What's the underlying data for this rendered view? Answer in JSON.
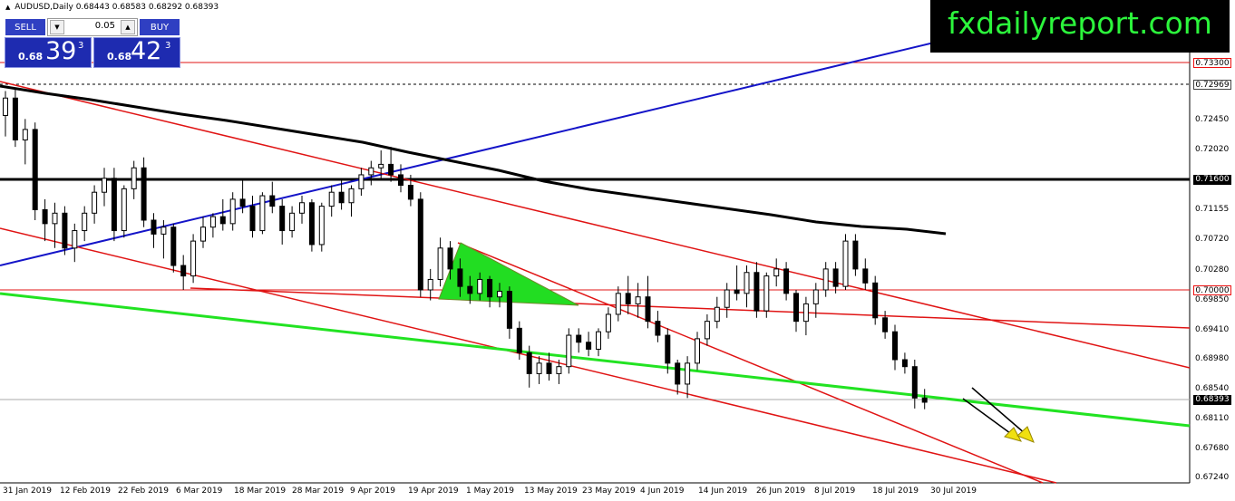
{
  "window": {
    "symbol_title": "AUDUSD,Daily",
    "ohlc": "0.68443 0.68583 0.68292 0.68393"
  },
  "trade_panel": {
    "sell_label": "SELL",
    "buy_label": "BUY",
    "lot_value": "0.05",
    "sell_price": {
      "prefix": "0.68",
      "big": "39",
      "sup": "3"
    },
    "buy_price": {
      "prefix": "0.68",
      "big": "42",
      "sup": "3"
    }
  },
  "watermark": "fxdailyreport.com",
  "price_axis": {
    "labels": [
      "0.72450",
      "0.72020",
      "0.71155",
      "0.70720",
      "0.70280",
      "0.69850",
      "0.69410",
      "0.68980",
      "0.68540",
      "0.68110",
      "0.67680",
      "0.67240"
    ],
    "tags": {
      "resistance_high": "0.73300",
      "dashed_level": "0.72969",
      "black_level": "0.71600",
      "round_level": "0.70000",
      "current_price": "0.68393"
    }
  },
  "time_axis": [
    "31 Jan 2019",
    "12 Feb 2019",
    "22 Feb 2019",
    "6 Mar 2019",
    "18 Mar 2019",
    "28 Mar 2019",
    "9 Apr 2019",
    "19 Apr 2019",
    "1 May 2019",
    "13 May 2019",
    "23 May 2019",
    "4 Jun 2019",
    "14 Jun 2019",
    "26 Jun 2019",
    "8 Jul 2019",
    "18 Jul 2019",
    "30 Jul 2019"
  ],
  "colors": {
    "trend_red": "#e01414",
    "trend_blue": "#1414c8",
    "support_green": "#22e322",
    "moving_average": "#000000",
    "triangle_fill": "#22dd22",
    "arrow_yellow": "#f0e010",
    "sell_button": "#2f3fc2",
    "logo_text": "#2cf53c"
  },
  "candles": [
    [
      0.725,
      0.7285,
      0.722,
      0.7275
    ],
    [
      0.7275,
      0.729,
      0.7205,
      0.7215
    ],
    [
      0.7215,
      0.7245,
      0.718,
      0.723
    ],
    [
      0.723,
      0.724,
      0.71,
      0.7115
    ],
    [
      0.7115,
      0.713,
      0.707,
      0.7095
    ],
    [
      0.7095,
      0.7125,
      0.706,
      0.711
    ],
    [
      0.711,
      0.712,
      0.705,
      0.706
    ],
    [
      0.706,
      0.7095,
      0.704,
      0.7085
    ],
    [
      0.7085,
      0.712,
      0.707,
      0.711
    ],
    [
      0.711,
      0.715,
      0.7095,
      0.714
    ],
    [
      0.714,
      0.7175,
      0.712,
      0.716
    ],
    [
      0.716,
      0.7175,
      0.707,
      0.7085
    ],
    [
      0.7085,
      0.715,
      0.7075,
      0.7145
    ],
    [
      0.7145,
      0.7185,
      0.713,
      0.7175
    ],
    [
      0.7175,
      0.719,
      0.709,
      0.71
    ],
    [
      0.71,
      0.711,
      0.706,
      0.708
    ],
    [
      0.708,
      0.71,
      0.7045,
      0.709
    ],
    [
      0.709,
      0.7095,
      0.7025,
      0.7035
    ],
    [
      0.7035,
      0.705,
      0.7,
      0.702
    ],
    [
      0.702,
      0.708,
      0.701,
      0.707
    ],
    [
      0.707,
      0.7105,
      0.706,
      0.709
    ],
    [
      0.709,
      0.711,
      0.7075,
      0.7105
    ],
    [
      0.7105,
      0.713,
      0.7085,
      0.7095
    ],
    [
      0.7095,
      0.714,
      0.7085,
      0.713
    ],
    [
      0.713,
      0.716,
      0.711,
      0.712
    ],
    [
      0.712,
      0.7135,
      0.7075,
      0.7085
    ],
    [
      0.7085,
      0.714,
      0.708,
      0.7135
    ],
    [
      0.7135,
      0.7155,
      0.711,
      0.712
    ],
    [
      0.712,
      0.713,
      0.7065,
      0.7085
    ],
    [
      0.7085,
      0.712,
      0.7075,
      0.711
    ],
    [
      0.711,
      0.7135,
      0.7095,
      0.7125
    ],
    [
      0.7125,
      0.713,
      0.7055,
      0.7065
    ],
    [
      0.7065,
      0.7125,
      0.7055,
      0.712
    ],
    [
      0.712,
      0.715,
      0.7105,
      0.714
    ],
    [
      0.714,
      0.716,
      0.7115,
      0.7125
    ],
    [
      0.7125,
      0.715,
      0.7105,
      0.7145
    ],
    [
      0.7145,
      0.7175,
      0.7135,
      0.7165
    ],
    [
      0.7165,
      0.7185,
      0.715,
      0.7175
    ],
    [
      0.7175,
      0.72,
      0.716,
      0.718
    ],
    [
      0.718,
      0.7205,
      0.7155,
      0.7165
    ],
    [
      0.7165,
      0.718,
      0.714,
      0.715
    ],
    [
      0.715,
      0.7165,
      0.712,
      0.713
    ],
    [
      0.713,
      0.714,
      0.699,
      0.7
    ],
    [
      0.7,
      0.703,
      0.6985,
      0.7015
    ],
    [
      0.7015,
      0.7075,
      0.7005,
      0.706
    ],
    [
      0.706,
      0.707,
      0.7015,
      0.703
    ],
    [
      0.703,
      0.7045,
      0.699,
      0.7005
    ],
    [
      0.7005,
      0.702,
      0.698,
      0.6995
    ],
    [
      0.6995,
      0.7025,
      0.6985,
      0.7015
    ],
    [
      0.7015,
      0.702,
      0.6975,
      0.699
    ],
    [
      0.699,
      0.701,
      0.6975,
      0.6998
    ],
    [
      0.6998,
      0.7005,
      0.693,
      0.6945
    ],
    [
      0.6945,
      0.6955,
      0.69,
      0.691
    ],
    [
      0.691,
      0.692,
      0.686,
      0.688
    ],
    [
      0.688,
      0.6905,
      0.6865,
      0.6895
    ],
    [
      0.6895,
      0.691,
      0.687,
      0.688
    ],
    [
      0.688,
      0.69,
      0.6865,
      0.689
    ],
    [
      0.689,
      0.6945,
      0.688,
      0.6935
    ],
    [
      0.6935,
      0.6945,
      0.691,
      0.6925
    ],
    [
      0.6925,
      0.694,
      0.6905,
      0.6915
    ],
    [
      0.6915,
      0.6945,
      0.6905,
      0.694
    ],
    [
      0.694,
      0.6975,
      0.693,
      0.6965
    ],
    [
      0.6965,
      0.7005,
      0.6955,
      0.6995
    ],
    [
      0.6995,
      0.702,
      0.6965,
      0.698
    ],
    [
      0.698,
      0.701,
      0.696,
      0.699
    ],
    [
      0.699,
      0.702,
      0.6945,
      0.6955
    ],
    [
      0.6955,
      0.697,
      0.6925,
      0.6935
    ],
    [
      0.6935,
      0.6945,
      0.688,
      0.6895
    ],
    [
      0.6895,
      0.69,
      0.685,
      0.6865
    ],
    [
      0.6865,
      0.6905,
      0.6845,
      0.6895
    ],
    [
      0.6895,
      0.694,
      0.6885,
      0.693
    ],
    [
      0.693,
      0.6965,
      0.692,
      0.6955
    ],
    [
      0.6955,
      0.699,
      0.6945,
      0.6975
    ],
    [
      0.6975,
      0.701,
      0.696,
      0.7
    ],
    [
      0.7,
      0.7035,
      0.6985,
      0.6995
    ],
    [
      0.6995,
      0.7035,
      0.6975,
      0.7025
    ],
    [
      0.7025,
      0.704,
      0.696,
      0.697
    ],
    [
      0.697,
      0.7025,
      0.696,
      0.702
    ],
    [
      0.702,
      0.7045,
      0.7005,
      0.703
    ],
    [
      0.703,
      0.704,
      0.6985,
      0.6995
    ],
    [
      0.6995,
      0.7,
      0.694,
      0.6955
    ],
    [
      0.6955,
      0.699,
      0.6935,
      0.698
    ],
    [
      0.698,
      0.701,
      0.696,
      0.7
    ],
    [
      0.7,
      0.704,
      0.699,
      0.703
    ],
    [
      0.703,
      0.704,
      0.6995,
      0.7005
    ],
    [
      0.7005,
      0.708,
      0.7,
      0.707
    ],
    [
      0.707,
      0.708,
      0.702,
      0.703
    ],
    [
      0.703,
      0.7045,
      0.7,
      0.701
    ],
    [
      0.701,
      0.702,
      0.695,
      0.696
    ],
    [
      0.696,
      0.697,
      0.693,
      0.694
    ],
    [
      0.694,
      0.695,
      0.6885,
      0.69
    ],
    [
      0.69,
      0.691,
      0.688,
      0.689
    ],
    [
      0.689,
      0.69,
      0.683,
      0.6845
    ],
    [
      0.6845,
      0.6858,
      0.6829,
      0.6839
    ]
  ]
}
